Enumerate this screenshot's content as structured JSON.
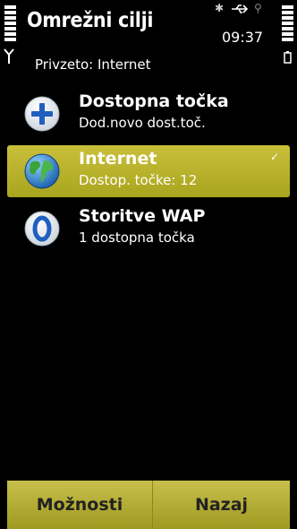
{
  "header": {
    "title": "Omrežni cilji",
    "time": "09:37",
    "subtitle": "Privzeto: Internet"
  },
  "status_icons": [
    "bluetooth-icon",
    "usb-icon",
    "gps-icon"
  ],
  "items": [
    {
      "title": "Dostopna točka",
      "subtitle": "Dod.novo dost.toč.",
      "icon": "plus-icon",
      "selected": false
    },
    {
      "title": "Internet",
      "subtitle": "Dostop. točke: 12",
      "icon": "globe-icon",
      "selected": true
    },
    {
      "title": "Storitve WAP",
      "subtitle": "1 dostopna točka",
      "icon": "zero-badge-icon",
      "selected": false
    }
  ],
  "softkeys": {
    "left": "Možnosti",
    "right": "Nazaj"
  },
  "colors": {
    "highlight": "#b8b12a",
    "softkey_bg": "#b5ae35"
  }
}
